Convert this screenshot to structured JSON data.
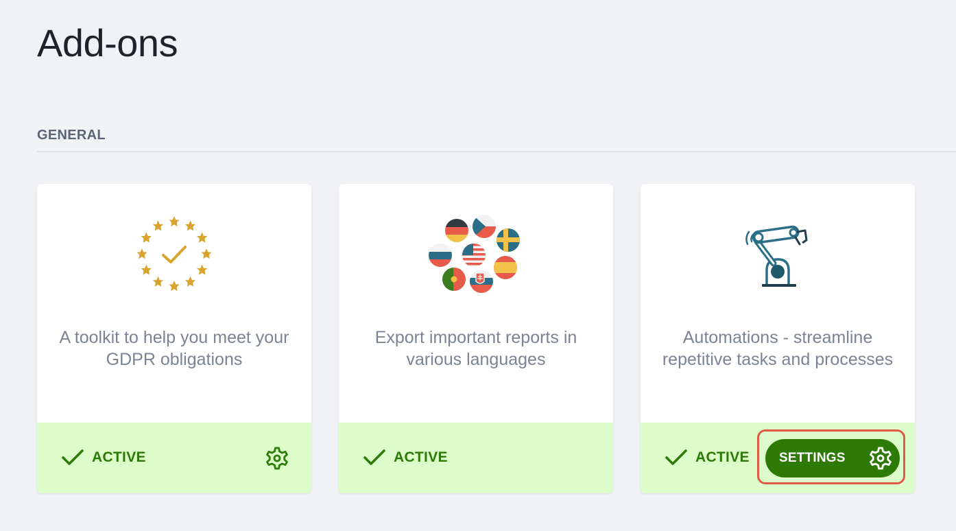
{
  "page": {
    "title": "Add-ons"
  },
  "section": {
    "heading": "GENERAL"
  },
  "addons": [
    {
      "icon": "eu-stars-check-icon",
      "description": "A toolkit to help you meet your GDPR obligations",
      "status": "ACTIVE",
      "has_gear": true
    },
    {
      "icon": "language-flags-icon",
      "description": "Export important reports in various languages",
      "status": "ACTIVE",
      "has_gear": false
    },
    {
      "icon": "robot-arm-icon",
      "description": "Automations - streamline repetitive tasks and processes",
      "status": "ACTIVE",
      "settings_label": "SETTINGS"
    }
  ],
  "colors": {
    "background": "#f0f2f5",
    "card": "#ffffff",
    "footer_active": "#dcfcca",
    "active_green": "#2e7a06",
    "highlight": "#e05a48",
    "gold": "#d9a42e",
    "teal": "#2a6f87"
  }
}
